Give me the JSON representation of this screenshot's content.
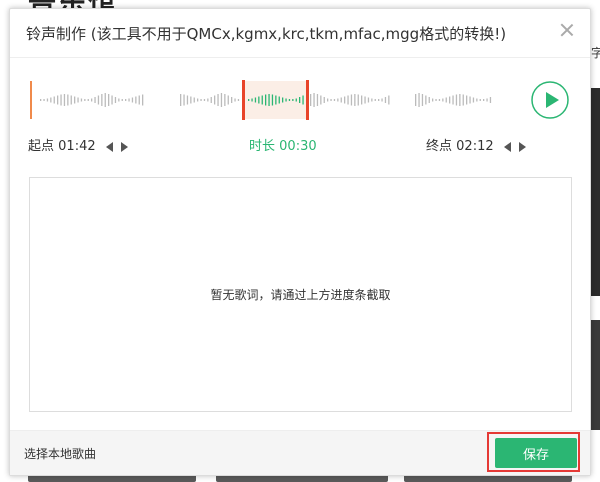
{
  "background": {
    "heading": "普乐馆",
    "right_char": "字"
  },
  "dialog": {
    "title": "铃声制作 (该工具不用于QMCx,kgmx,krc,tkm,mfac,mgg格式的转换!)",
    "close_icon": "close-icon",
    "play_icon": "play-icon",
    "start": {
      "label": "起点",
      "time": "01:42"
    },
    "duration": {
      "label": "时长",
      "time": "00:30"
    },
    "end": {
      "label": "终点",
      "time": "02:12"
    },
    "lyrics_empty_message": "暂无歌词，请通过上方进度条截取",
    "local_song_link": "选择本地歌曲",
    "save_button": "保存"
  },
  "colors": {
    "accent": "#2bb673",
    "marker": "#e8442a",
    "selection_bg": "#fbeee6",
    "highlight_box": "#e53935",
    "wave_inactive": "#bbbbbb"
  }
}
